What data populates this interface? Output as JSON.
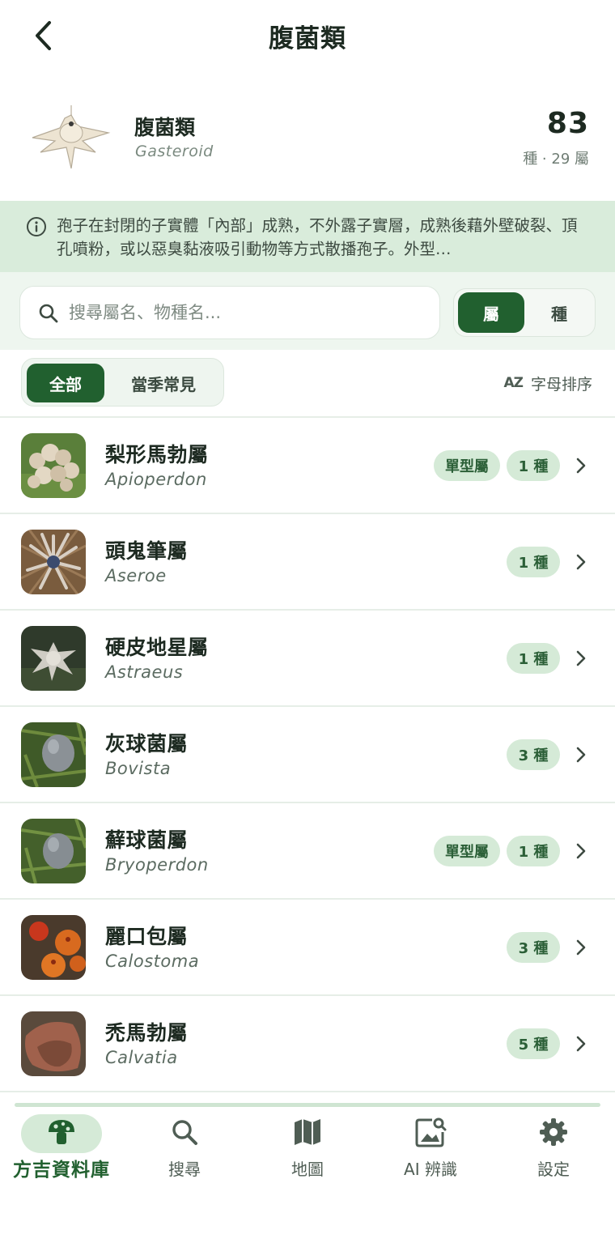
{
  "nav": {
    "title": "腹菌類"
  },
  "header": {
    "name": "腹菌類",
    "latin": "Gasteroid",
    "count": "83",
    "sub": "種 · 29 屬"
  },
  "info": {
    "text": "孢子在封閉的子實體「內部」成熟，不外露子實層，成熟後藉外壁破裂、頂孔噴粉，或以惡臭黏液吸引動物等方式散播孢子。外型…"
  },
  "search": {
    "placeholder": "搜尋屬名、物種名..."
  },
  "segment": {
    "genus": "屬",
    "species": "種"
  },
  "filters": {
    "all": "全部",
    "seasonal": "當季常見"
  },
  "sort": {
    "icon_text": "AZ",
    "label": "字母排序"
  },
  "genera": [
    {
      "name": "梨形馬勃屬",
      "latin": "Apioperdon",
      "monotypic": "單型屬",
      "count": "1 種",
      "thumb": "puffballs"
    },
    {
      "name": "頭鬼筆屬",
      "latin": "Aseroe",
      "monotypic": "",
      "count": "1 種",
      "thumb": "starfish"
    },
    {
      "name": "硬皮地星屬",
      "latin": "Astraeus",
      "monotypic": "",
      "count": "1 種",
      "thumb": "earthstar"
    },
    {
      "name": "灰球菌屬",
      "latin": "Bovista",
      "monotypic": "",
      "count": "3 種",
      "thumb": "grayball"
    },
    {
      "name": "蘚球菌屬",
      "latin": "Bryoperdon",
      "monotypic": "單型屬",
      "count": "1 種",
      "thumb": "grayball"
    },
    {
      "name": "麗口包屬",
      "latin": "Calostoma",
      "monotypic": "",
      "count": "3 種",
      "thumb": "orange"
    },
    {
      "name": "禿馬勃屬",
      "latin": "Calvatia",
      "monotypic": "",
      "count": "5 種",
      "thumb": "brown"
    }
  ],
  "tabs": [
    {
      "label": "方吉資料庫",
      "icon": "mushroom-icon",
      "active": true
    },
    {
      "label": "搜尋",
      "icon": "search-icon",
      "active": false
    },
    {
      "label": "地圖",
      "icon": "map-icon",
      "active": false
    },
    {
      "label": "AI 辨識",
      "icon": "ai-image-icon",
      "active": false
    },
    {
      "label": "設定",
      "icon": "gear-icon",
      "active": false
    }
  ],
  "colors": {
    "primary": "#21602f",
    "badge_bg": "#d5ead7",
    "info_bg": "#d9ecdb"
  }
}
